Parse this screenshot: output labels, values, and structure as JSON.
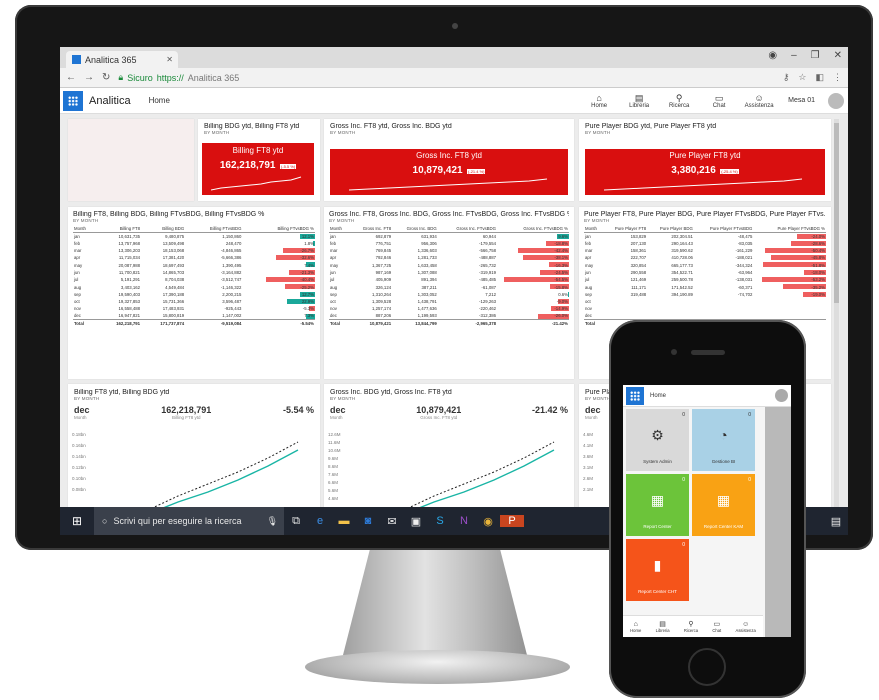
{
  "browser": {
    "tab_title": "Analitica 365",
    "secure_label": "Sicuro",
    "url_scheme": "https://",
    "url_host": "Analitica 365"
  },
  "app": {
    "brand": "Analitica",
    "home_link": "Home",
    "nav": [
      {
        "label": "Home",
        "icon": "home-icon"
      },
      {
        "label": "Libreria",
        "icon": "library-icon"
      },
      {
        "label": "Ricerca",
        "icon": "search-icon"
      },
      {
        "label": "Chat",
        "icon": "chat-icon"
      },
      {
        "label": "Assistenza",
        "icon": "people-icon"
      }
    ],
    "user": "Mesa 01"
  },
  "kpi_cards": [
    {
      "title": "Billing BDG ytd, Billing FT8 ytd",
      "sub": "BY MONTH",
      "kpi_title": "Billing FT8 ytd",
      "kpi_value": "162,218,791",
      "kpi_delta": "(-5.5 %)"
    },
    {
      "title": "Gross Inc. FT8 ytd, Gross Inc. BDG ytd",
      "sub": "BY MONTH",
      "kpi_title": "Gross Inc. FT8 ytd",
      "kpi_value": "10,879,421",
      "kpi_delta": "(-21.4 %)"
    },
    {
      "title": "Pure Player BDG ytd, Pure Player FT8 ytd",
      "sub": "BY MONTH",
      "kpi_title": "Pure Player FT8 ytd",
      "kpi_value": "3,380,216",
      "kpi_delta": "(-25.4 %)"
    }
  ],
  "tables": [
    {
      "title": "Billing FT8, Billing BDG, Billing FTvsBDG, Billing FTvsBDG %",
      "sub": "BY MONTH",
      "columns": [
        "Month",
        "Billing FT8",
        "Billing BDG",
        "Billing FTvsBDG",
        "Billing FTvsBDG %"
      ],
      "rows": [
        [
          "jan",
          "10,631,735",
          "9,480,875",
          "1,150,860",
          "12.1%"
        ],
        [
          "feb",
          "13,757,968",
          "13,509,498",
          "248,470",
          "1.8%"
        ],
        [
          "mar",
          "13,306,203",
          "18,153,068",
          "-4,846,865",
          "-26.7%"
        ],
        [
          "apr",
          "11,715,034",
          "17,381,420",
          "-5,666,386",
          "-32.6%"
        ],
        [
          "may",
          "20,087,988",
          "18,697,493",
          "1,390,495",
          "7.4%"
        ],
        [
          "jun",
          "11,700,821",
          "14,865,703",
          "-3,164,882",
          "-21.3%"
        ],
        [
          "jul",
          "5,191,291",
          "8,704,038",
          "-3,512,747",
          "-40.4%"
        ],
        [
          "aug",
          "3,403,162",
          "4,549,484",
          "-1,146,322",
          "-25.2%"
        ],
        [
          "sep",
          "19,590,403",
          "17,390,188",
          "2,200,215",
          "12.7%"
        ],
        [
          "oct",
          "19,327,853",
          "15,731,366",
          "3,596,487",
          "22.9%"
        ],
        [
          "nov",
          "16,558,488",
          "17,483,931",
          "-925,443",
          "-5.3%"
        ],
        [
          "dec",
          "16,947,821",
          "15,800,819",
          "1,147,002",
          "7.3%"
        ]
      ],
      "pct": [
        12.1,
        1.8,
        -26.7,
        -32.6,
        7.4,
        -21.3,
        -40.4,
        -25.2,
        12.7,
        22.9,
        -5.3,
        7.3
      ],
      "total": [
        "Total",
        "162,218,791",
        "171,737,874",
        "-9,519,084",
        "-5.54%"
      ]
    },
    {
      "title": "Gross Inc. FT8, Gross Inc. BDG, Gross Inc. FTvsBDG, Gross Inc. FTvsBDG %",
      "sub": "BY MONTH",
      "columns": [
        "Month",
        "Gross Inc. FT8",
        "Gross Inc. BDG",
        "Gross Inc. FTvsBDG",
        "Gross Inc. FTvsBDG %"
      ],
      "rows": [
        [
          "jan",
          "692,879",
          "631,934",
          "60,944",
          "9.6%"
        ],
        [
          "feb",
          "776,751",
          "956,306",
          "-179,554",
          "-18.8%"
        ],
        [
          "mar",
          "769,845",
          "1,336,603",
          "-566,758",
          "-42.4%"
        ],
        [
          "apr",
          "792,846",
          "1,281,733",
          "-488,887",
          "-38.1%"
        ],
        [
          "may",
          "1,367,725",
          "1,633,458",
          "-265,732",
          "-16.3%"
        ],
        [
          "jun",
          "987,169",
          "1,307,088",
          "-319,919",
          "-24.5%"
        ],
        [
          "jul",
          "405,909",
          "891,394",
          "-485,485",
          "-54.5%"
        ],
        [
          "aug",
          "326,124",
          "387,211",
          "-61,087",
          "-15.8%"
        ],
        [
          "sep",
          "1,310,264",
          "1,303,052",
          "7,212",
          "0.6%"
        ],
        [
          "oct",
          "1,309,528",
          "1,438,791",
          "-129,263",
          "-9.0%"
        ],
        [
          "nov",
          "1,257,174",
          "1,477,636",
          "-220,462",
          "-14.9%"
        ],
        [
          "dec",
          "887,206",
          "1,199,593",
          "-312,386",
          "-26.0%"
        ]
      ],
      "pct": [
        9.6,
        -18.8,
        -42.4,
        -38.1,
        -16.3,
        -24.5,
        -54.5,
        -15.8,
        0.6,
        -9.0,
        -14.9,
        -26.0
      ],
      "total": [
        "Total",
        "10,879,421",
        "13,844,799",
        "-2,965,378",
        "-21.42%"
      ]
    },
    {
      "title": "Pure Player FT8, Pure Player BDG, Pure Player FTvsBDG, Pure Player FTvs...",
      "sub": "BY MONTH",
      "columns": [
        "Month",
        "Pure Player FT8",
        "Pure Player BDG",
        "Pure Player FTvsBDG",
        "Pure Player FTvsBDG %"
      ],
      "rows": [
        [
          "jan",
          "153,829",
          "202,304.51",
          "-48,475",
          "-24.0%"
        ],
        [
          "feb",
          "207,130",
          "290,164.43",
          "-83,035",
          "-28.6%"
        ],
        [
          "mar",
          "158,361",
          "319,590.62",
          "-161,229",
          "-50.4%"
        ],
        [
          "apr",
          "222,707",
          "410,728.06",
          "-188,021",
          "-45.8%"
        ],
        [
          "may",
          "320,854",
          "665,177.73",
          "-344,324",
          "-51.8%"
        ],
        [
          "jun",
          "290,558",
          "354,522.71",
          "-63,964",
          "-18.0%"
        ],
        [
          "jul",
          "121,469",
          "259,500.78",
          "-138,031",
          "-53.2%"
        ],
        [
          "aug",
          "111,171",
          "171,542.52",
          "-60,371",
          "-35.2%"
        ],
        [
          "sep",
          "319,488",
          "394,190.89",
          "-74,702",
          "-19.0%"
        ],
        [
          "oct",
          "",
          "",
          "",
          ""
        ],
        [
          "nov",
          "",
          "",
          "",
          ""
        ],
        [
          "dec",
          "",
          "",
          "",
          ""
        ]
      ],
      "pct": [
        -24.0,
        -28.6,
        -50.4,
        -45.8,
        -51.8,
        -18.0,
        -53.2,
        -35.2,
        -19.0
      ],
      "total": [
        "Total",
        "",
        "",
        "",
        ""
      ]
    }
  ],
  "line_cards": [
    {
      "title": "Billing FT8 ytd, Billing BDG ytd",
      "sub": "BY MONTH",
      "period": "dec",
      "period_sub": "Month",
      "value": "162,218,791",
      "value_sub": "Billing FT8 ytd",
      "delta": "-5.54 %",
      "yticks": [
        "0.18bn",
        "0.16bn",
        "0.14bn",
        "0.12bn",
        "0.10bn",
        "0.08bn"
      ]
    },
    {
      "title": "Gross Inc. BDG ytd, Gross Inc. FT8 ytd",
      "sub": "BY MONTH",
      "period": "dec",
      "period_sub": "Month",
      "value": "10,879,421",
      "value_sub": "Gross Inc. FT8 ytd",
      "delta": "-21.42 %",
      "yticks": [
        "12.6M",
        "11.6M",
        "10.6M",
        "9.6M",
        "8.6M",
        "7.6M",
        "6.6M",
        "5.6M",
        "4.6M"
      ]
    },
    {
      "title": "Pure Player",
      "sub": "BY MONTH",
      "period": "dec",
      "period_sub": "Month",
      "value": "",
      "value_sub": "",
      "delta": "",
      "yticks": [
        "4.6M",
        "4.1M",
        "3.6M",
        "3.1M",
        "2.6M",
        "2.1M"
      ]
    }
  ],
  "taskbar": {
    "search_placeholder": "Scrivi qui per eseguire la ricerca",
    "apps": [
      "task-view-icon",
      "edge-icon",
      "explorer-icon",
      "outlook-icon",
      "mail-icon",
      "store-icon",
      "skype-icon",
      "onenote-icon",
      "chrome-icon",
      "powerpoint-icon"
    ]
  },
  "phone": {
    "home": "Home",
    "tiles": [
      {
        "label": "System Admin",
        "count": "0",
        "color": "#d9d9d9",
        "text_color": "#333",
        "icon": "gear-icon"
      },
      {
        "label": "Gestione BI",
        "count": "0",
        "color": "#a9d1e6",
        "text_color": "#333",
        "icon": "pie-chart-icon"
      },
      {
        "label": "Report Center",
        "count": "0",
        "color": "#6cc43a",
        "text_color": "#fff",
        "icon": "report-icon"
      },
      {
        "label": "Report Center KAM",
        "count": "0",
        "color": "#f9a214",
        "text_color": "#fff",
        "icon": "report-kam-icon"
      },
      {
        "label": "Report Center CHT",
        "count": "0",
        "color": "#f5541a",
        "text_color": "#fff",
        "icon": "bar-chart-icon"
      }
    ],
    "nav": [
      "Home",
      "Libreria",
      "Ricerca",
      "Chat",
      "Assistenza"
    ]
  },
  "colors": {
    "accent": "#1e74d3",
    "kpi_red": "#d90f0f",
    "neg_bar": "#ef5f5f",
    "pos_bar": "#1aa89a",
    "line_actual": "#19b5a5"
  }
}
